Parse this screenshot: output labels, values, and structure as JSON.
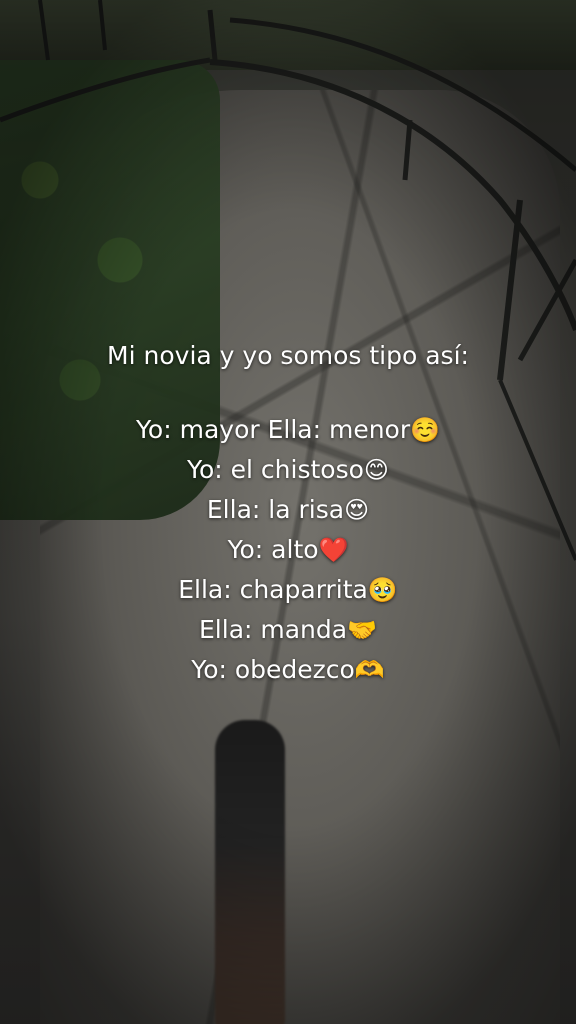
{
  "caption": {
    "title": "Mi novia y yo somos tipo así:",
    "lines": [
      {
        "text": "Yo: mayor Ella: menor",
        "emoji": "☺️"
      },
      {
        "text": "Yo: el chistoso",
        "emoji": "😊"
      },
      {
        "text": "Ella: la risa",
        "emoji": "😍"
      },
      {
        "text": "Yo: alto",
        "emoji": "❤️"
      },
      {
        "text": "Ella: chaparrita",
        "emoji": "🥹"
      },
      {
        "text": "Ella: manda",
        "emoji": "🤝"
      },
      {
        "text": "Yo: obedezco",
        "emoji": "🫶"
      }
    ]
  },
  "scene": {
    "description_colors": {
      "hedge": "#31472a",
      "path": "#5c5a55",
      "rail": "#1e1f1d"
    }
  }
}
